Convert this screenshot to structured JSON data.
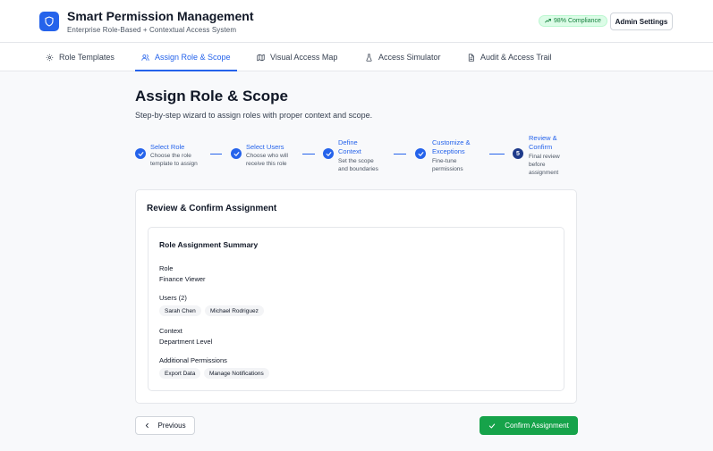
{
  "header": {
    "title": "Smart Permission Management",
    "subtitle": "Enterprise Role-Based + Contextual Access System",
    "compliance": "98% Compliance",
    "admin_settings": "Admin Settings"
  },
  "nav": {
    "tabs": [
      {
        "label": "Role Templates",
        "icon": "gear-icon"
      },
      {
        "label": "Assign Role & Scope",
        "icon": "users-icon",
        "active": true
      },
      {
        "label": "Visual Access Map",
        "icon": "map-icon"
      },
      {
        "label": "Access Simulator",
        "icon": "flask-icon"
      },
      {
        "label": "Audit & Access Trail",
        "icon": "document-icon"
      }
    ]
  },
  "page": {
    "title": "Assign Role & Scope",
    "description": "Step-by-step wizard to assign roles with proper context and scope."
  },
  "wizard": {
    "steps": [
      {
        "title": "Select Role",
        "desc_l1": "Choose the role",
        "desc_l2": "template to assign",
        "state": "complete"
      },
      {
        "title": "Select Users",
        "desc_l1": "Choose who will",
        "desc_l2": "receive this role",
        "state": "complete"
      },
      {
        "title_l1": "Define",
        "title_l2": "Context",
        "desc_l1": "Set the scope",
        "desc_l2": "and boundaries",
        "state": "complete"
      },
      {
        "title_l1": "Customize &",
        "title_l2": "Exceptions",
        "desc_l1": "Fine-tune",
        "desc_l2": "permissions",
        "state": "complete"
      },
      {
        "number": "5",
        "title_l1": "Review &",
        "title_l2": "Confirm",
        "desc_l1": "Final review",
        "desc_l2": "before",
        "desc_l3": "assignment",
        "state": "current"
      }
    ]
  },
  "review": {
    "title": "Review & Confirm Assignment",
    "summary_title": "Role Assignment Summary",
    "role_label": "Role",
    "role_value": "Finance Viewer",
    "users_label": "Users (2)",
    "users": [
      "Sarah Chen",
      "Michael Rodriguez"
    ],
    "context_label": "Context",
    "context_value": "Department Level",
    "permissions_label": "Additional Permissions",
    "permissions": [
      "Export Data",
      "Manage Notifications"
    ]
  },
  "actions": {
    "previous": "Previous",
    "confirm": "Confirm Assignment"
  },
  "colors": {
    "primary": "#2563eb",
    "success": "#16a34a",
    "compliance_bg": "#dcfce7"
  }
}
